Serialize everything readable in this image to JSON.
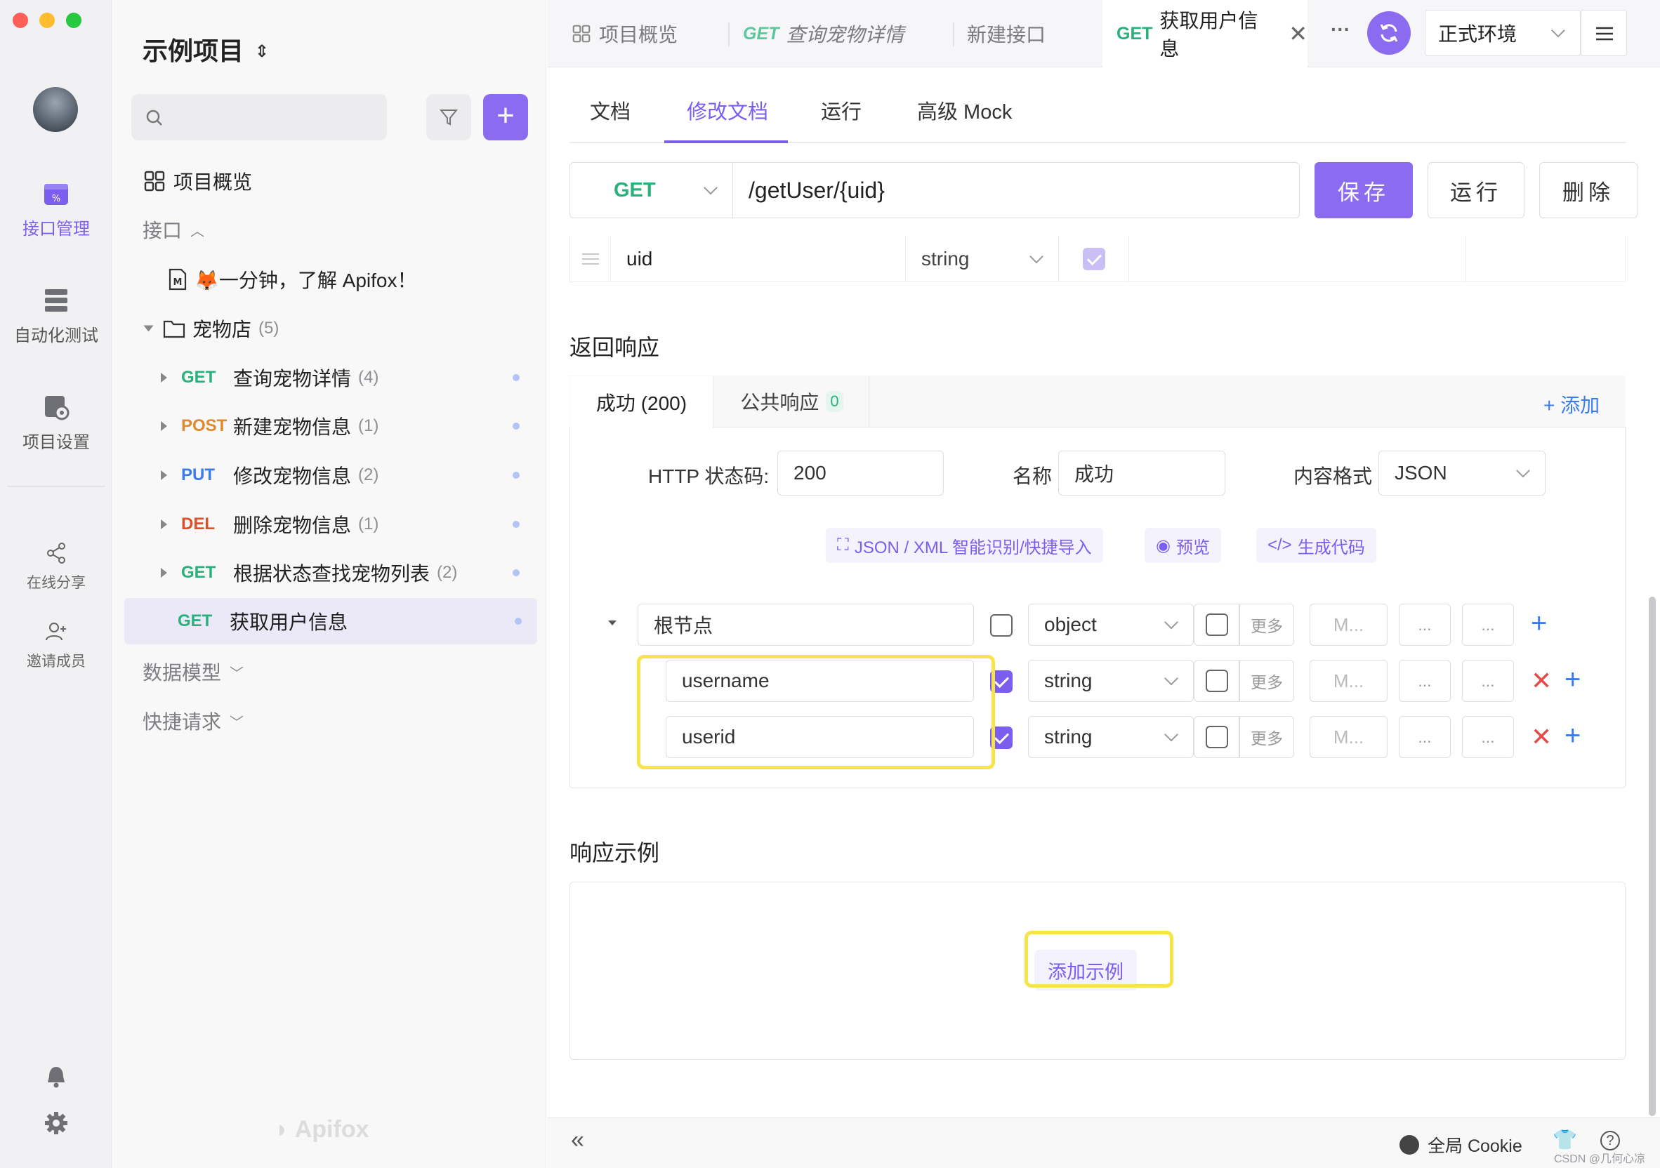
{
  "rail": {
    "items": [
      {
        "label": "接口管理",
        "icon": "api-management-icon"
      },
      {
        "label": "自动化测试",
        "icon": "automation-test-icon"
      },
      {
        "label": "项目设置",
        "icon": "project-settings-icon"
      },
      {
        "label": "在线分享",
        "icon": "share-icon"
      },
      {
        "label": "邀请成员",
        "icon": "invite-member-icon"
      }
    ]
  },
  "sidebar": {
    "project_title": "示例项目",
    "overview": "项目概览",
    "api_group": "接口",
    "intro_doc": "🦊一分钟，了解 Apifox！",
    "folder": {
      "name": "宠物店",
      "count": "(5)"
    },
    "endpoints": [
      {
        "method": "GET",
        "name": "查询宠物详情",
        "count": "(4)",
        "color": "#2ab07d"
      },
      {
        "method": "POST",
        "name": "新建宠物信息",
        "count": "(1)",
        "color": "#e2892b"
      },
      {
        "method": "PUT",
        "name": "修改宠物信息",
        "count": "(2)",
        "color": "#3a7bf2"
      },
      {
        "method": "DEL",
        "name": "删除宠物信息",
        "count": "(1)",
        "color": "#e04e2b"
      },
      {
        "method": "GET",
        "name": "根据状态查找宠物列表",
        "count": "(2)",
        "color": "#2ab07d"
      }
    ],
    "selected": {
      "method": "GET",
      "name": "获取用户信息"
    },
    "data_model": "数据模型",
    "quick_request": "快捷请求",
    "watermark": "Apifox"
  },
  "topbar": {
    "tabs": [
      {
        "prefix": "",
        "label": "项目概览"
      },
      {
        "prefix": "GET",
        "label": "查询宠物详情"
      },
      {
        "prefix": "",
        "label": "新建接口"
      },
      {
        "prefix": "GET",
        "label": "获取用户信息"
      }
    ],
    "more": "···",
    "env": "正式环境"
  },
  "subtabs": [
    "文档",
    "修改文档",
    "运行",
    "高级 Mock"
  ],
  "request": {
    "method": "GET",
    "path": "/getUser/{uid}",
    "save": "保存",
    "run": "运行",
    "delete": "删除"
  },
  "param_row": {
    "name": "uid",
    "type": "string"
  },
  "response": {
    "heading": "返回响应",
    "tabs": [
      {
        "label": "成功 (200)"
      },
      {
        "label": "公共响应",
        "badge": "0"
      }
    ],
    "add": "+ 添加",
    "status_label": "HTTP 状态码:",
    "status_value": "200",
    "name_label": "名称",
    "name_value": "成功",
    "format_label": "内容格式",
    "format_value": "JSON",
    "tools": [
      "JSON / XML 智能识别/快捷导入",
      "预览",
      "生成代码"
    ],
    "schema": [
      {
        "field": "根节点",
        "type": "object",
        "more": "更多",
        "mock": "M...",
        "e1": "...",
        "e2": "..."
      },
      {
        "field": "username",
        "type": "string",
        "more": "更多",
        "mock": "M...",
        "e1": "...",
        "e2": "..."
      },
      {
        "field": "userid",
        "type": "string",
        "more": "更多",
        "mock": "M...",
        "e1": "...",
        "e2": "..."
      }
    ]
  },
  "example": {
    "heading": "响应示例",
    "add": "添加示例"
  },
  "bottombar": {
    "collapse": "«",
    "cookie": "全局 Cookie",
    "help": "?"
  },
  "watermark_csdn": "CSDN @几何心凉"
}
